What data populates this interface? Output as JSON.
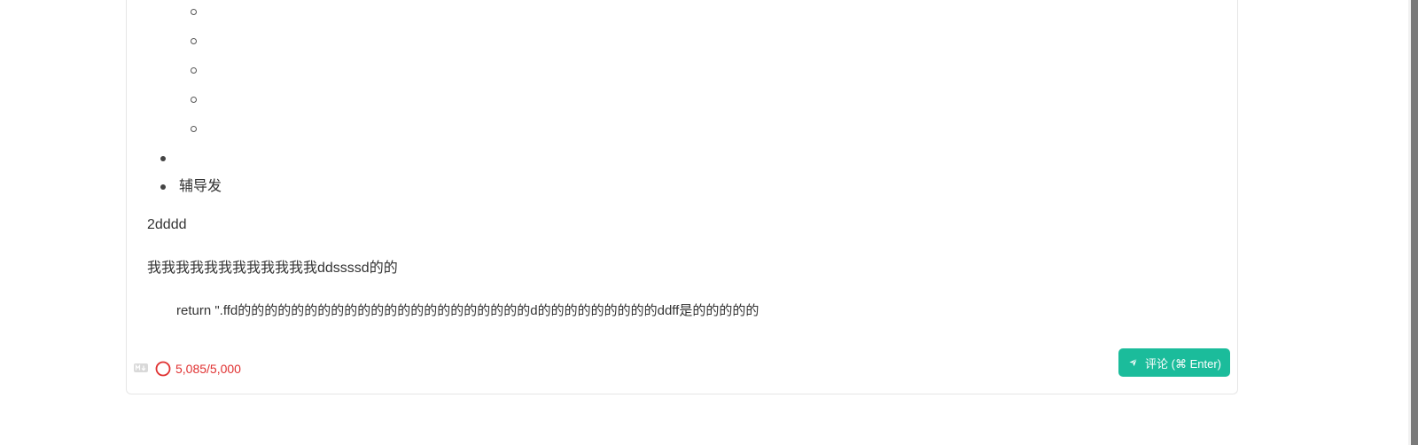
{
  "editor": {
    "sub_list_items": [
      "",
      "",
      "",
      "",
      ""
    ],
    "top_list_items": [
      "",
      "辅导发"
    ],
    "paragraph_1": "2dddd",
    "paragraph_2": "我我我我我我我我我我我我ddssssd的的",
    "code_line": "return \".ffd的的的的的的的的的的的的的的的的的的的的的的d的的的的的的的的的ddff是的的的的的"
  },
  "footer": {
    "markdown_icon": "markdown-icon",
    "char_count": "5,085/5,000",
    "count_color": "#e03131",
    "submit_label": "评论 (⌘ Enter)",
    "submit_icon": "send-icon",
    "submit_color": "#1bbc9b"
  }
}
